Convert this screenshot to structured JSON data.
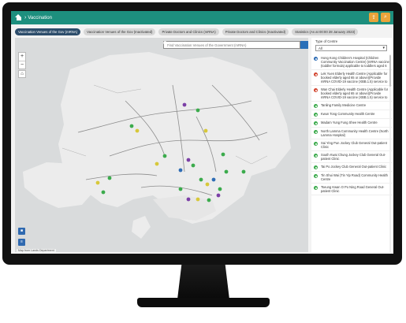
{
  "header": {
    "breadcrumb": "Vaccination",
    "icons": [
      "home-icon",
      "share-icon",
      "search-icon"
    ]
  },
  "tabs": [
    {
      "label": "Vaccination Venues of the Gov (mRNA)",
      "active": true
    },
    {
      "label": "Vaccination Venues of the Gov (Inactivated)",
      "active": false
    },
    {
      "label": "Private Doctors and Clinics (mRNA)",
      "active": false
    },
    {
      "label": "Private Doctors and Clinics (Inactivated)",
      "active": false
    },
    {
      "label": "Statistics (As at 00:00 28 January 2023)",
      "active": false
    }
  ],
  "map": {
    "search_placeholder": "Find Vaccination Venues of the Government (mRNA)",
    "zoom_in": "+",
    "zoom_out": "−",
    "home": "⌂",
    "attribution": "Map from Lands Department",
    "colors": {
      "water": "#d9dbdc",
      "land": "#ececec",
      "road": "#8c8c8c"
    }
  },
  "panel": {
    "filter_label": "Type of Centre",
    "filter_value": "All",
    "items": [
      {
        "label": "Hong Kong Children's Hospital (Children Community Vaccination Centre) (mRNA vaccine (toddler formula) applicable to toddlers aged 6",
        "status": "blue"
      },
      {
        "label": "Lek Yuen Elderly Health Centre (Applicable for booked elderly aged 65 or above)(Provide mRNA COVID-19 vaccine (XBB.1.5) service to",
        "status": "red"
      },
      {
        "label": "Wan Chai Elderly Health Centre (Applicable for booked elderly aged 65 or above)(Provide mRNA COVID-19 vaccine (XBB.1.5) service to",
        "status": "red"
      },
      {
        "label": "Tanling Family Medicine Centre",
        "status": "green"
      },
      {
        "label": "Kwun Tong Community Health Centre",
        "status": "green"
      },
      {
        "label": "Madam Yung Fung Shee Health Centre",
        "status": "green"
      },
      {
        "label": "North Lamma Community Health Centre (North Lamma Hospital)",
        "status": "green"
      },
      {
        "label": "Sai Ying Pun Jockey Club General Out-patient Clinic",
        "status": "green"
      },
      {
        "label": "South Kwai Chung Jockey Club General Out-patient Clinic",
        "status": "green"
      },
      {
        "label": "Tai Po Jockey Club General Out-patient Clinic",
        "status": "green"
      },
      {
        "label": "Tin Shui Wai (Tin Yip Road) Community Health Centre",
        "status": "green"
      },
      {
        "label": "Tseung Kwan O Po Ning Road General Out-patient Clinic",
        "status": "green"
      }
    ],
    "status_colors": {
      "blue": "#2f6db5",
      "red": "#d2452f",
      "green": "#3bab4c"
    }
  }
}
